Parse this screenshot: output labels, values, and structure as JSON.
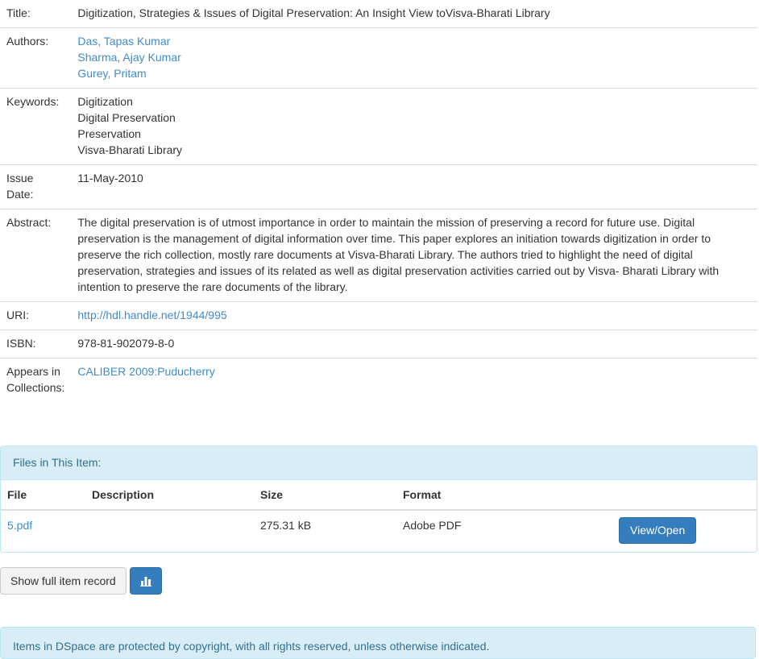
{
  "metadata": {
    "title_label": "Title:",
    "title_value": "Digitization, Strategies & Issues of Digital Preservation: An Insight View toVisva-Bharati Library",
    "authors_label": "Authors:",
    "authors": [
      "Das, Tapas Kumar",
      "Sharma, Ajay Kumar",
      "Gurey, Pritam"
    ],
    "keywords_label": "Keywords:",
    "keywords": [
      "Digitization",
      "Digital Preservation",
      "Preservation",
      "Visva-Bharati Library"
    ],
    "issue_date_label_1": "Issue",
    "issue_date_label_2": "Date:",
    "issue_date": "11-May-2010",
    "abstract_label": "Abstract:",
    "abstract": "The digital preservation is of utmost importance in order to maintain the mission of preserving a record for future use. Digital preservation is the management of digital information over time. This paper explores an initiation towards digitization in order to preserve the rich collection, mostly rare documents at Visva-Bharati Library. The authors tried to highlight the need of digital preservation, strategies and issues of its related as well as digital preservation activities carried out by Visva- Bharati Library with intention to preserve the rare documents of the library.",
    "uri_label": "URI:",
    "uri": "http://hdl.handle.net/1944/995",
    "isbn_label": "ISBN:",
    "isbn": "978-81-902079-8-0",
    "collections_label_1": "Appears in",
    "collections_label_2": "Collections:",
    "collection": "CALIBER 2009:Puducherry"
  },
  "files_panel": {
    "heading": "Files in This Item:",
    "columns": [
      "File",
      "Description",
      "Size",
      "Format"
    ],
    "rows": [
      {
        "file": "5.pdf",
        "description": "",
        "size": "275.31 kB",
        "format": "Adobe PDF",
        "action": "View/Open"
      }
    ]
  },
  "actions": {
    "full_record": "Show full item record",
    "stats_icon": "bar-chart-icon"
  },
  "footer": {
    "notice": "Items in DSpace are protected by copyright, with all rights reserved, unless otherwise indicated."
  }
}
